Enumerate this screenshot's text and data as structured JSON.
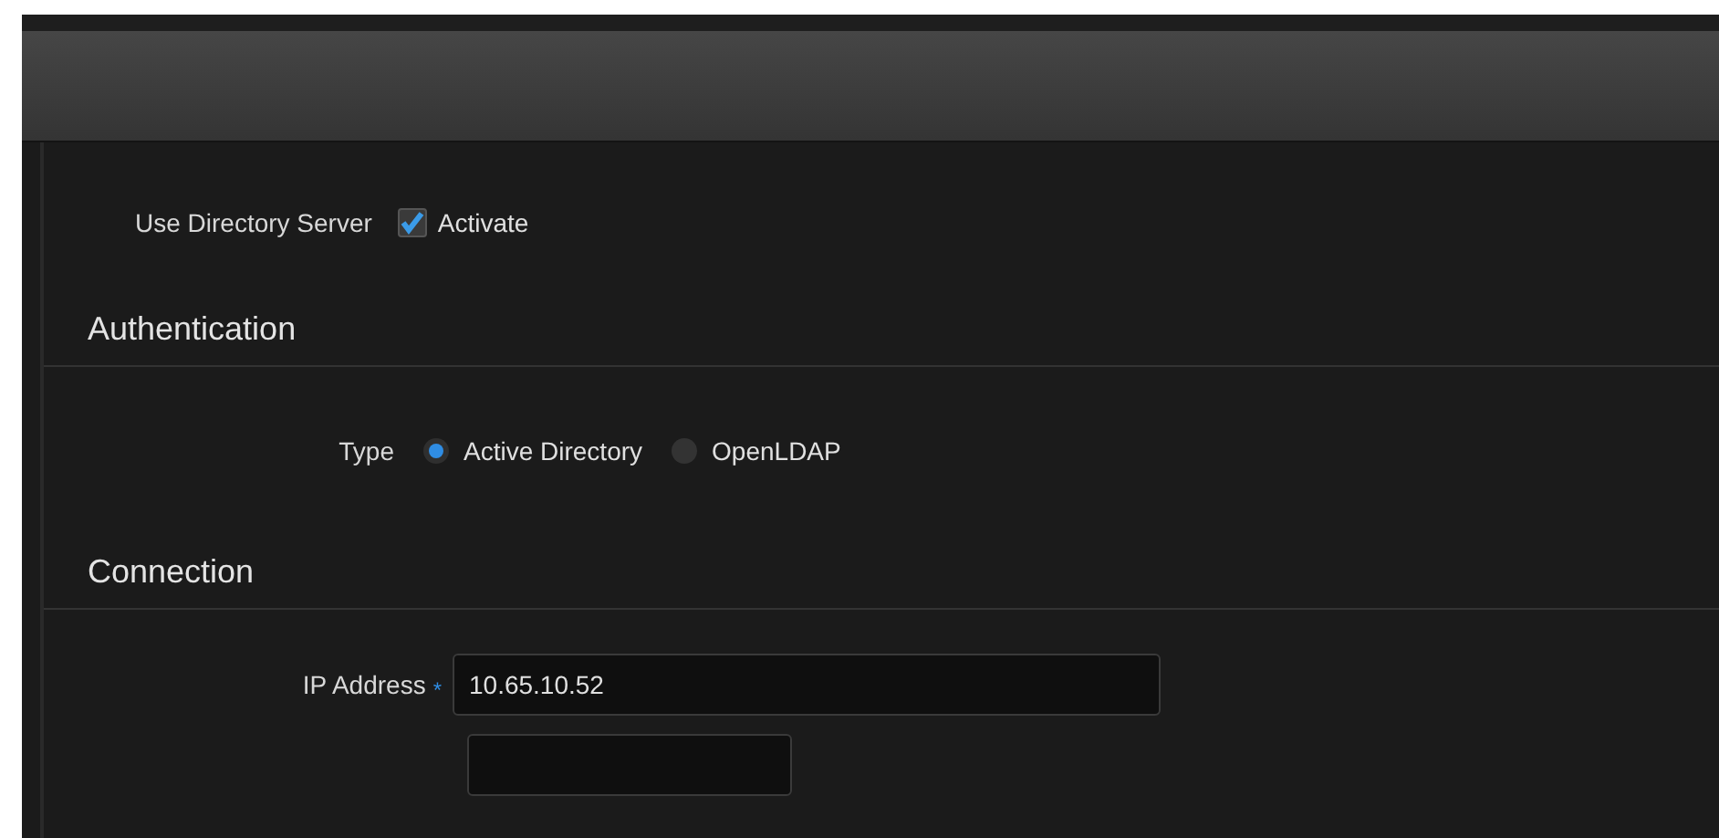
{
  "directory_server": {
    "label": "Use Directory Server",
    "option": "Activate",
    "checked": true
  },
  "sections": [
    {
      "title": "Authentication",
      "type_row": {
        "label": "Type",
        "options": [
          {
            "label": "Active Directory",
            "selected": true
          },
          {
            "label": "OpenLDAP",
            "selected": false
          }
        ]
      }
    },
    {
      "title": "Connection",
      "fields": [
        {
          "label": "IP Address",
          "required_mark": "*",
          "value": "10.65.10.52"
        },
        {
          "kind": "empty"
        }
      ]
    }
  ]
}
